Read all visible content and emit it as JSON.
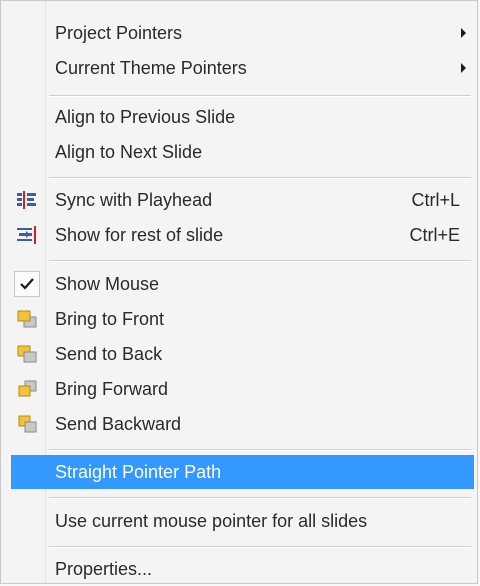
{
  "menu": {
    "items": [
      {
        "label": "Project Pointers"
      },
      {
        "label": "Current Theme Pointers"
      },
      {
        "label": "Align to Previous Slide"
      },
      {
        "label": "Align to Next Slide"
      },
      {
        "label": "Sync with Playhead",
        "shortcut": "Ctrl+L",
        "icon": "sync-playhead-icon"
      },
      {
        "label": "Show for rest of slide",
        "shortcut": "Ctrl+E",
        "icon": "show-rest-icon"
      },
      {
        "label": "Show Mouse",
        "icon": "checkmark-icon"
      },
      {
        "label": "Bring to Front",
        "icon": "bring-to-front-icon"
      },
      {
        "label": "Send to Back",
        "icon": "send-to-back-icon"
      },
      {
        "label": "Bring Forward",
        "icon": "bring-forward-icon"
      },
      {
        "label": "Send Backward",
        "icon": "send-backward-icon"
      },
      {
        "label": "Straight Pointer Path"
      },
      {
        "label": "Use current mouse pointer for all slides"
      },
      {
        "label": "Properties..."
      }
    ]
  },
  "colors": {
    "highlight": "#3399ff",
    "text": "#2a2a2a",
    "background": "#f4f4f4"
  }
}
